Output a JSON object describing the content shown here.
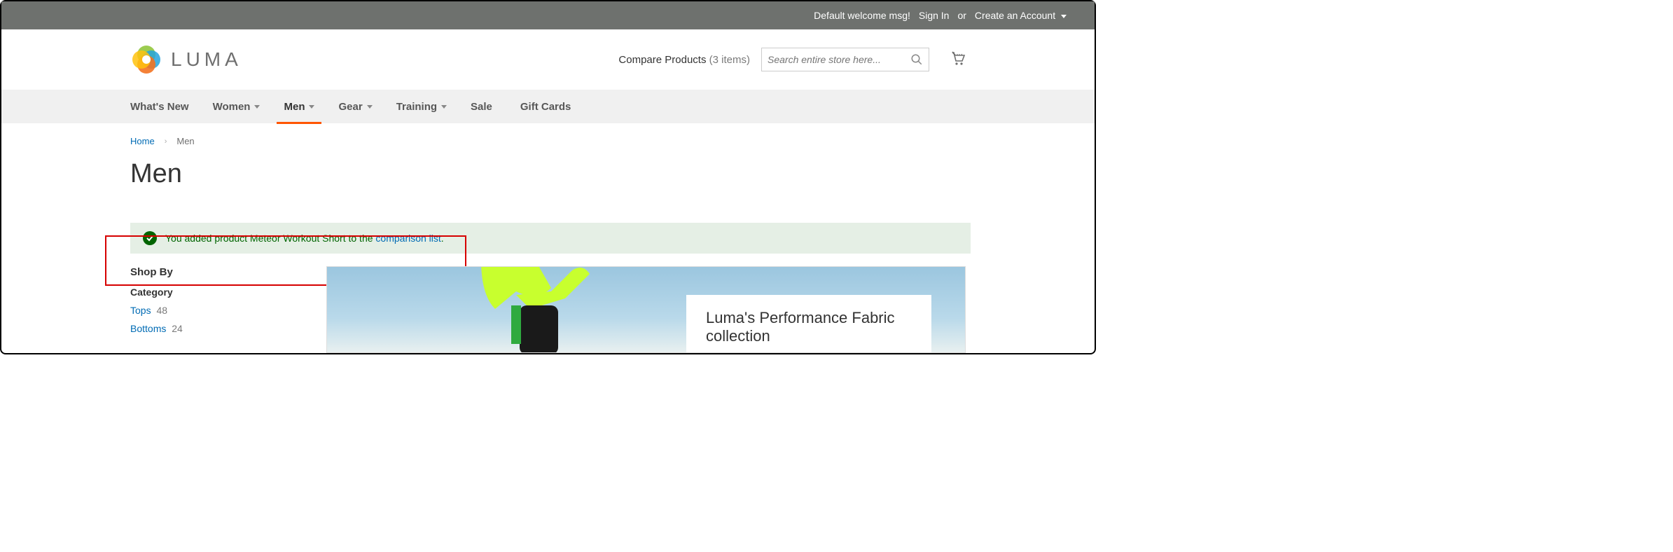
{
  "topbar": {
    "welcome": "Default welcome msg!",
    "signin": "Sign In",
    "or": "or",
    "create": "Create an Account"
  },
  "header": {
    "logo_text": "LUMA",
    "compare_label": "Compare Products",
    "compare_count": "(3 items)",
    "search_placeholder": "Search entire store here..."
  },
  "nav": {
    "items": [
      {
        "label": "What's New",
        "dropdown": false
      },
      {
        "label": "Women",
        "dropdown": true
      },
      {
        "label": "Men",
        "dropdown": true,
        "active": true
      },
      {
        "label": "Gear",
        "dropdown": true
      },
      {
        "label": "Training",
        "dropdown": true
      },
      {
        "label": "Sale",
        "dropdown": false
      },
      {
        "label": "Gift Cards",
        "dropdown": false
      }
    ]
  },
  "breadcrumb": {
    "home": "Home",
    "current": "Men"
  },
  "page_title": "Men",
  "message": {
    "prefix": "You added product Meteor Workout Short to the ",
    "link": "comparison list",
    "suffix": "."
  },
  "sidebar": {
    "shop_by": "Shop By",
    "category_label": "Category",
    "categories": [
      {
        "label": "Tops",
        "count": "48"
      },
      {
        "label": "Bottoms",
        "count": "24"
      }
    ]
  },
  "banner": {
    "headline": "Luma's Performance Fabric collection"
  }
}
